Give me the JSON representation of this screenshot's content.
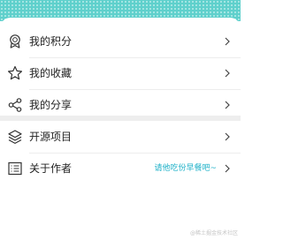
{
  "menu": {
    "points": {
      "label": "我的积分",
      "icon": "badge-icon"
    },
    "favorites": {
      "label": "我的收藏",
      "icon": "star-icon"
    },
    "shares": {
      "label": "我的分享",
      "icon": "share-icon"
    },
    "open_source": {
      "label": "开源项目",
      "icon": "layers-icon"
    },
    "about_author": {
      "label": "关于作者",
      "value": "请他吃份早餐吧~",
      "icon": "document-list-icon"
    }
  },
  "watermark": "@稀土掘金技术社区",
  "colors": {
    "header": "#5fd0cc",
    "accent_text": "#20b2c9",
    "icon_stroke": "#333333",
    "chevron": "#444444"
  }
}
